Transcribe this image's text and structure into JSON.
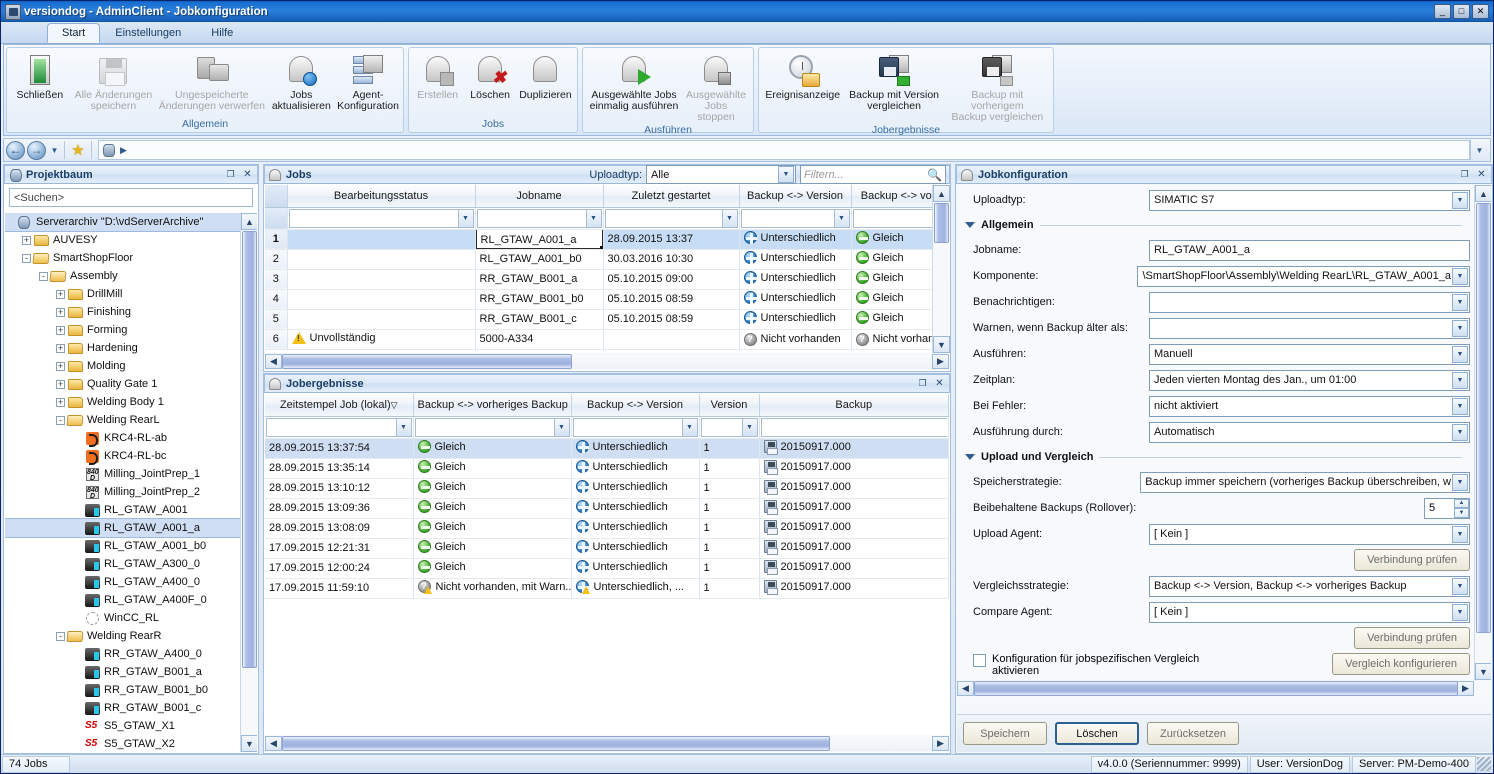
{
  "window": {
    "title": "versiondog - AdminClient - Jobkonfiguration",
    "minimize": "_",
    "maximize": "□",
    "close": "✕"
  },
  "ribbon": {
    "tabs": [
      {
        "label": "Start",
        "active": true
      },
      {
        "label": "Einstellungen",
        "active": false
      },
      {
        "label": "Hilfe",
        "active": false
      }
    ],
    "groups": [
      {
        "label": "Allgemein",
        "buttons": [
          {
            "label": "Schließen",
            "icon": "door-icon",
            "disabled": false
          },
          {
            "label": "Alle Änderungen\nspeichern",
            "icon": "save-icon",
            "disabled": true
          },
          {
            "label": "Ungespeicherte\nÄnderungen verwerfen",
            "icon": "discard-icon",
            "disabled": true
          },
          {
            "label": "Jobs\naktualisieren",
            "icon": "refresh-jobs-icon",
            "disabled": false
          },
          {
            "label": "Agent-\nKonfiguration",
            "icon": "agent-config-icon",
            "disabled": false
          }
        ]
      },
      {
        "label": "Jobs",
        "buttons": [
          {
            "label": "Erstellen",
            "icon": "add-job-icon",
            "disabled": true
          },
          {
            "label": "Löschen",
            "icon": "delete-job-icon",
            "disabled": false
          },
          {
            "label": "Duplizieren",
            "icon": "duplicate-job-icon",
            "disabled": false
          }
        ]
      },
      {
        "label": "Ausführen",
        "buttons": [
          {
            "label": "Ausgewählte Jobs\neinmalig ausführen",
            "icon": "run-job-icon",
            "disabled": false
          },
          {
            "label": "Ausgewählte\nJobs stoppen",
            "icon": "stop-job-icon",
            "disabled": true
          }
        ]
      },
      {
        "label": "Jobergebnisse",
        "buttons": [
          {
            "label": "Ereignisanzeige",
            "icon": "event-log-icon",
            "disabled": false
          },
          {
            "label": "Backup mit Version\nvergleichen",
            "icon": "compare-version-icon",
            "disabled": false
          },
          {
            "label": "Backup mit vorherigem\nBackup vergleichen",
            "icon": "compare-backup-icon",
            "disabled": true
          }
        ]
      }
    ]
  },
  "navbar": {
    "back": "back-icon",
    "forward": "forward-icon",
    "history_dropdown": "chevron-down-icon",
    "favorites": "star-icon",
    "path_icon": "archive-icon",
    "path_arrow": "chevron-right-icon",
    "overflow": "chevron-down-icon"
  },
  "tree_panel": {
    "title": "Projektbaum",
    "icon": "archive-icon",
    "restore_label": "❐",
    "close_label": "✕",
    "search_placeholder": "<Suchen>",
    "nodes": [
      {
        "label": "Serverarchiv \"D:\\vdServerArchive\"",
        "depth": 0,
        "icon": "db",
        "toggle": "",
        "selected": true
      },
      {
        "label": "AUVESY",
        "depth": 1,
        "icon": "folder",
        "toggle": "+"
      },
      {
        "label": "SmartShopFloor",
        "depth": 1,
        "icon": "folder-open",
        "toggle": "-"
      },
      {
        "label": "Assembly",
        "depth": 2,
        "icon": "folder-open",
        "toggle": "-"
      },
      {
        "label": "DrillMill",
        "depth": 3,
        "icon": "folder",
        "toggle": "+"
      },
      {
        "label": "Finishing",
        "depth": 3,
        "icon": "folder",
        "toggle": "+"
      },
      {
        "label": "Forming",
        "depth": 3,
        "icon": "folder",
        "toggle": "+"
      },
      {
        "label": "Hardening",
        "depth": 3,
        "icon": "folder",
        "toggle": "+"
      },
      {
        "label": "Molding",
        "depth": 3,
        "icon": "folder",
        "toggle": "+"
      },
      {
        "label": "Quality Gate 1",
        "depth": 3,
        "icon": "folder",
        "toggle": "+"
      },
      {
        "label": "Welding Body 1",
        "depth": 3,
        "icon": "folder",
        "toggle": "+"
      },
      {
        "label": "Welding RearL",
        "depth": 3,
        "icon": "folder-open",
        "toggle": "-"
      },
      {
        "label": "KRC4-RL-ab",
        "depth": 4,
        "icon": "kuka",
        "toggle": ""
      },
      {
        "label": "KRC4-RL-bc",
        "depth": 4,
        "icon": "kuka",
        "toggle": ""
      },
      {
        "label": "Milling_JointPrep_1",
        "depth": 4,
        "icon": "sinumerik",
        "toggle": ""
      },
      {
        "label": "Milling_JointPrep_2",
        "depth": 4,
        "icon": "sinumerik",
        "toggle": ""
      },
      {
        "label": "RL_GTAW_A001",
        "depth": 4,
        "icon": "plc",
        "toggle": ""
      },
      {
        "label": "RL_GTAW_A001_a",
        "depth": 4,
        "icon": "plc",
        "toggle": "",
        "selected": true
      },
      {
        "label": "RL_GTAW_A001_b0",
        "depth": 4,
        "icon": "plc",
        "toggle": ""
      },
      {
        "label": "RL_GTAW_A300_0",
        "depth": 4,
        "icon": "plc",
        "toggle": ""
      },
      {
        "label": "RL_GTAW_A400_0",
        "depth": 4,
        "icon": "plc",
        "toggle": ""
      },
      {
        "label": "RL_GTAW_A400F_0",
        "depth": 4,
        "icon": "plc",
        "toggle": ""
      },
      {
        "label": "WinCC_RL",
        "depth": 4,
        "icon": "wincc",
        "toggle": ""
      },
      {
        "label": "Welding RearR",
        "depth": 3,
        "icon": "folder-open",
        "toggle": "-"
      },
      {
        "label": "RR_GTAW_A400_0",
        "depth": 4,
        "icon": "plc",
        "toggle": ""
      },
      {
        "label": "RR_GTAW_B001_a",
        "depth": 4,
        "icon": "plc",
        "toggle": ""
      },
      {
        "label": "RR_GTAW_B001_b0",
        "depth": 4,
        "icon": "plc",
        "toggle": ""
      },
      {
        "label": "RR_GTAW_B001_c",
        "depth": 4,
        "icon": "plc",
        "toggle": ""
      },
      {
        "label": "S5_GTAW_X1",
        "depth": 4,
        "icon": "s5",
        "toggle": ""
      },
      {
        "label": "S5_GTAW_X2",
        "depth": 4,
        "icon": "s5",
        "toggle": ""
      }
    ]
  },
  "jobs_panel": {
    "title": "Jobs",
    "icon": "bell-icon",
    "uploadtype_label": "Uploadtyp:",
    "uploadtype_value": "Alle",
    "filter_placeholder": "Filtern...",
    "search_icon": "search-icon",
    "columns": [
      "Bearbeitungsstatus",
      "Jobname",
      "Zuletzt gestartet",
      "Backup <-> Version",
      "Backup <-> vorher"
    ],
    "rows": [
      {
        "num": "1",
        "status": "",
        "status_icon": "",
        "jobname": "RL_GTAW_A001_a",
        "started": "28.09.2015 13:37",
        "bv": "Unterschiedlich",
        "bv_icon": "diff",
        "bp": "Gleich",
        "bp_icon": "same",
        "selected": true
      },
      {
        "num": "2",
        "status": "",
        "status_icon": "",
        "jobname": "RL_GTAW_A001_b0",
        "started": "30.03.2016 10:30",
        "bv": "Unterschiedlich",
        "bv_icon": "diff",
        "bp": "Gleich",
        "bp_icon": "same"
      },
      {
        "num": "3",
        "status": "",
        "status_icon": "",
        "jobname": "RR_GTAW_B001_a",
        "started": "05.10.2015 09:00",
        "bv": "Unterschiedlich",
        "bv_icon": "diff",
        "bp": "Gleich",
        "bp_icon": "same"
      },
      {
        "num": "4",
        "status": "",
        "status_icon": "",
        "jobname": "RR_GTAW_B001_b0",
        "started": "05.10.2015 08:59",
        "bv": "Unterschiedlich",
        "bv_icon": "diff",
        "bp": "Gleich",
        "bp_icon": "same"
      },
      {
        "num": "5",
        "status": "",
        "status_icon": "",
        "jobname": "RR_GTAW_B001_c",
        "started": "05.10.2015 08:59",
        "bv": "Unterschiedlich",
        "bv_icon": "diff",
        "bp": "Gleich",
        "bp_icon": "same"
      },
      {
        "num": "6",
        "status": "Unvollständig",
        "status_icon": "warning",
        "jobname": "5000-A334",
        "started": "",
        "bv": "Nicht vorhanden",
        "bv_icon": "none",
        "bp": "Nicht vorhanden",
        "bp_icon": "none"
      }
    ]
  },
  "results_panel": {
    "title": "Jobergebnisse",
    "icon": "results-icon",
    "restore_label": "❐",
    "close_label": "✕",
    "columns": [
      "Zeitstempel Job (lokal)",
      "Backup <-> vorheriges Backup",
      "Backup <-> Version",
      "Version",
      "Backup"
    ],
    "sort_indicator": "▽",
    "rows": [
      {
        "ts": "28.09.2015 13:37:54",
        "prev": "Gleich",
        "prev_icon": "same",
        "ver": "Unterschiedlich",
        "ver_icon": "diff",
        "version": "1",
        "backup": "20150917.000",
        "selected": true
      },
      {
        "ts": "28.09.2015 13:35:14",
        "prev": "Gleich",
        "prev_icon": "same",
        "ver": "Unterschiedlich",
        "ver_icon": "diff",
        "version": "1",
        "backup": "20150917.000"
      },
      {
        "ts": "28.09.2015 13:10:12",
        "prev": "Gleich",
        "prev_icon": "same",
        "ver": "Unterschiedlich",
        "ver_icon": "diff",
        "version": "1",
        "backup": "20150917.000"
      },
      {
        "ts": "28.09.2015 13:09:36",
        "prev": "Gleich",
        "prev_icon": "same",
        "ver": "Unterschiedlich",
        "ver_icon": "diff",
        "version": "1",
        "backup": "20150917.000"
      },
      {
        "ts": "28.09.2015 13:08:09",
        "prev": "Gleich",
        "prev_icon": "same",
        "ver": "Unterschiedlich",
        "ver_icon": "diff",
        "version": "1",
        "backup": "20150917.000"
      },
      {
        "ts": "17.09.2015 12:21:31",
        "prev": "Gleich",
        "prev_icon": "same",
        "ver": "Unterschiedlich",
        "ver_icon": "diff",
        "version": "1",
        "backup": "20150917.000"
      },
      {
        "ts": "17.09.2015 12:00:24",
        "prev": "Gleich",
        "prev_icon": "same",
        "ver": "Unterschiedlich",
        "ver_icon": "diff",
        "version": "1",
        "backup": "20150917.000"
      },
      {
        "ts": "17.09.2015 11:59:10",
        "prev": "Nicht vorhanden, mit Warn...",
        "prev_icon": "none-warn",
        "ver": "Unterschiedlich, ...",
        "ver_icon": "diff-warn",
        "version": "1",
        "backup": "20150917.000"
      }
    ]
  },
  "config_panel": {
    "title": "Jobkonfiguration",
    "icon": "config-icon",
    "restore_label": "❐",
    "close_label": "✕",
    "uploadtype_label": "Uploadtyp:",
    "uploadtype_value": "SIMATIC S7",
    "section_general": "Allgemein",
    "section_upload": "Upload und Vergleich",
    "fields": [
      {
        "label": "Jobname:",
        "value": "RL_GTAW_A001_a",
        "type": "text"
      },
      {
        "label": "Komponente:",
        "value": "\\SmartShopFloor\\Assembly\\Welding RearL\\RL_GTAW_A001_a",
        "type": "combo"
      },
      {
        "label": "Benachrichtigen:",
        "value": "",
        "type": "combo"
      },
      {
        "label": "Warnen, wenn Backup älter als:",
        "value": "",
        "type": "combo"
      },
      {
        "label": "Ausführen:",
        "value": "Manuell",
        "type": "combo"
      },
      {
        "label": "Zeitplan:",
        "value": "Jeden vierten Montag des Jan., um 01:00",
        "type": "combo"
      },
      {
        "label": "Bei Fehler:",
        "value": "nicht aktiviert",
        "type": "combo"
      },
      {
        "label": "Ausführung durch:",
        "value": "Automatisch",
        "type": "combo"
      }
    ],
    "upload_fields": [
      {
        "label": "Speicherstrategie:",
        "value": "Backup immer speichern (vorheriges Backup überschreiben, w",
        "type": "combo"
      },
      {
        "label": "Beibehaltene Backups (Rollover):",
        "value": "5",
        "type": "spin"
      },
      {
        "label": "Upload Agent:",
        "value": "[ Kein ]",
        "type": "combo"
      }
    ],
    "check_connection_upload": "Verbindung prüfen",
    "compare_fields": [
      {
        "label": "Vergleichsstrategie:",
        "value": "Backup <-> Version, Backup <-> vorheriges Backup",
        "type": "combo"
      },
      {
        "label": "Compare Agent:",
        "value": "[ Kein ]",
        "type": "combo"
      }
    ],
    "check_connection_compare": "Verbindung prüfen",
    "jobspecific_checkbox_label": "Konfiguration für jobspezifischen Vergleich aktivieren",
    "configure_compare_button": "Vergleich konfigurieren",
    "footer_buttons": [
      {
        "label": "Speichern",
        "state": "disabled"
      },
      {
        "label": "Löschen",
        "state": "default"
      },
      {
        "label": "Zurücksetzen",
        "state": "disabled"
      }
    ]
  },
  "statusbar": {
    "jobs_count": "74 Jobs",
    "version": "v4.0.0 (Seriennummer: 9999)",
    "user": "User: VersionDog",
    "server": "Server: PM-Demo-400"
  }
}
